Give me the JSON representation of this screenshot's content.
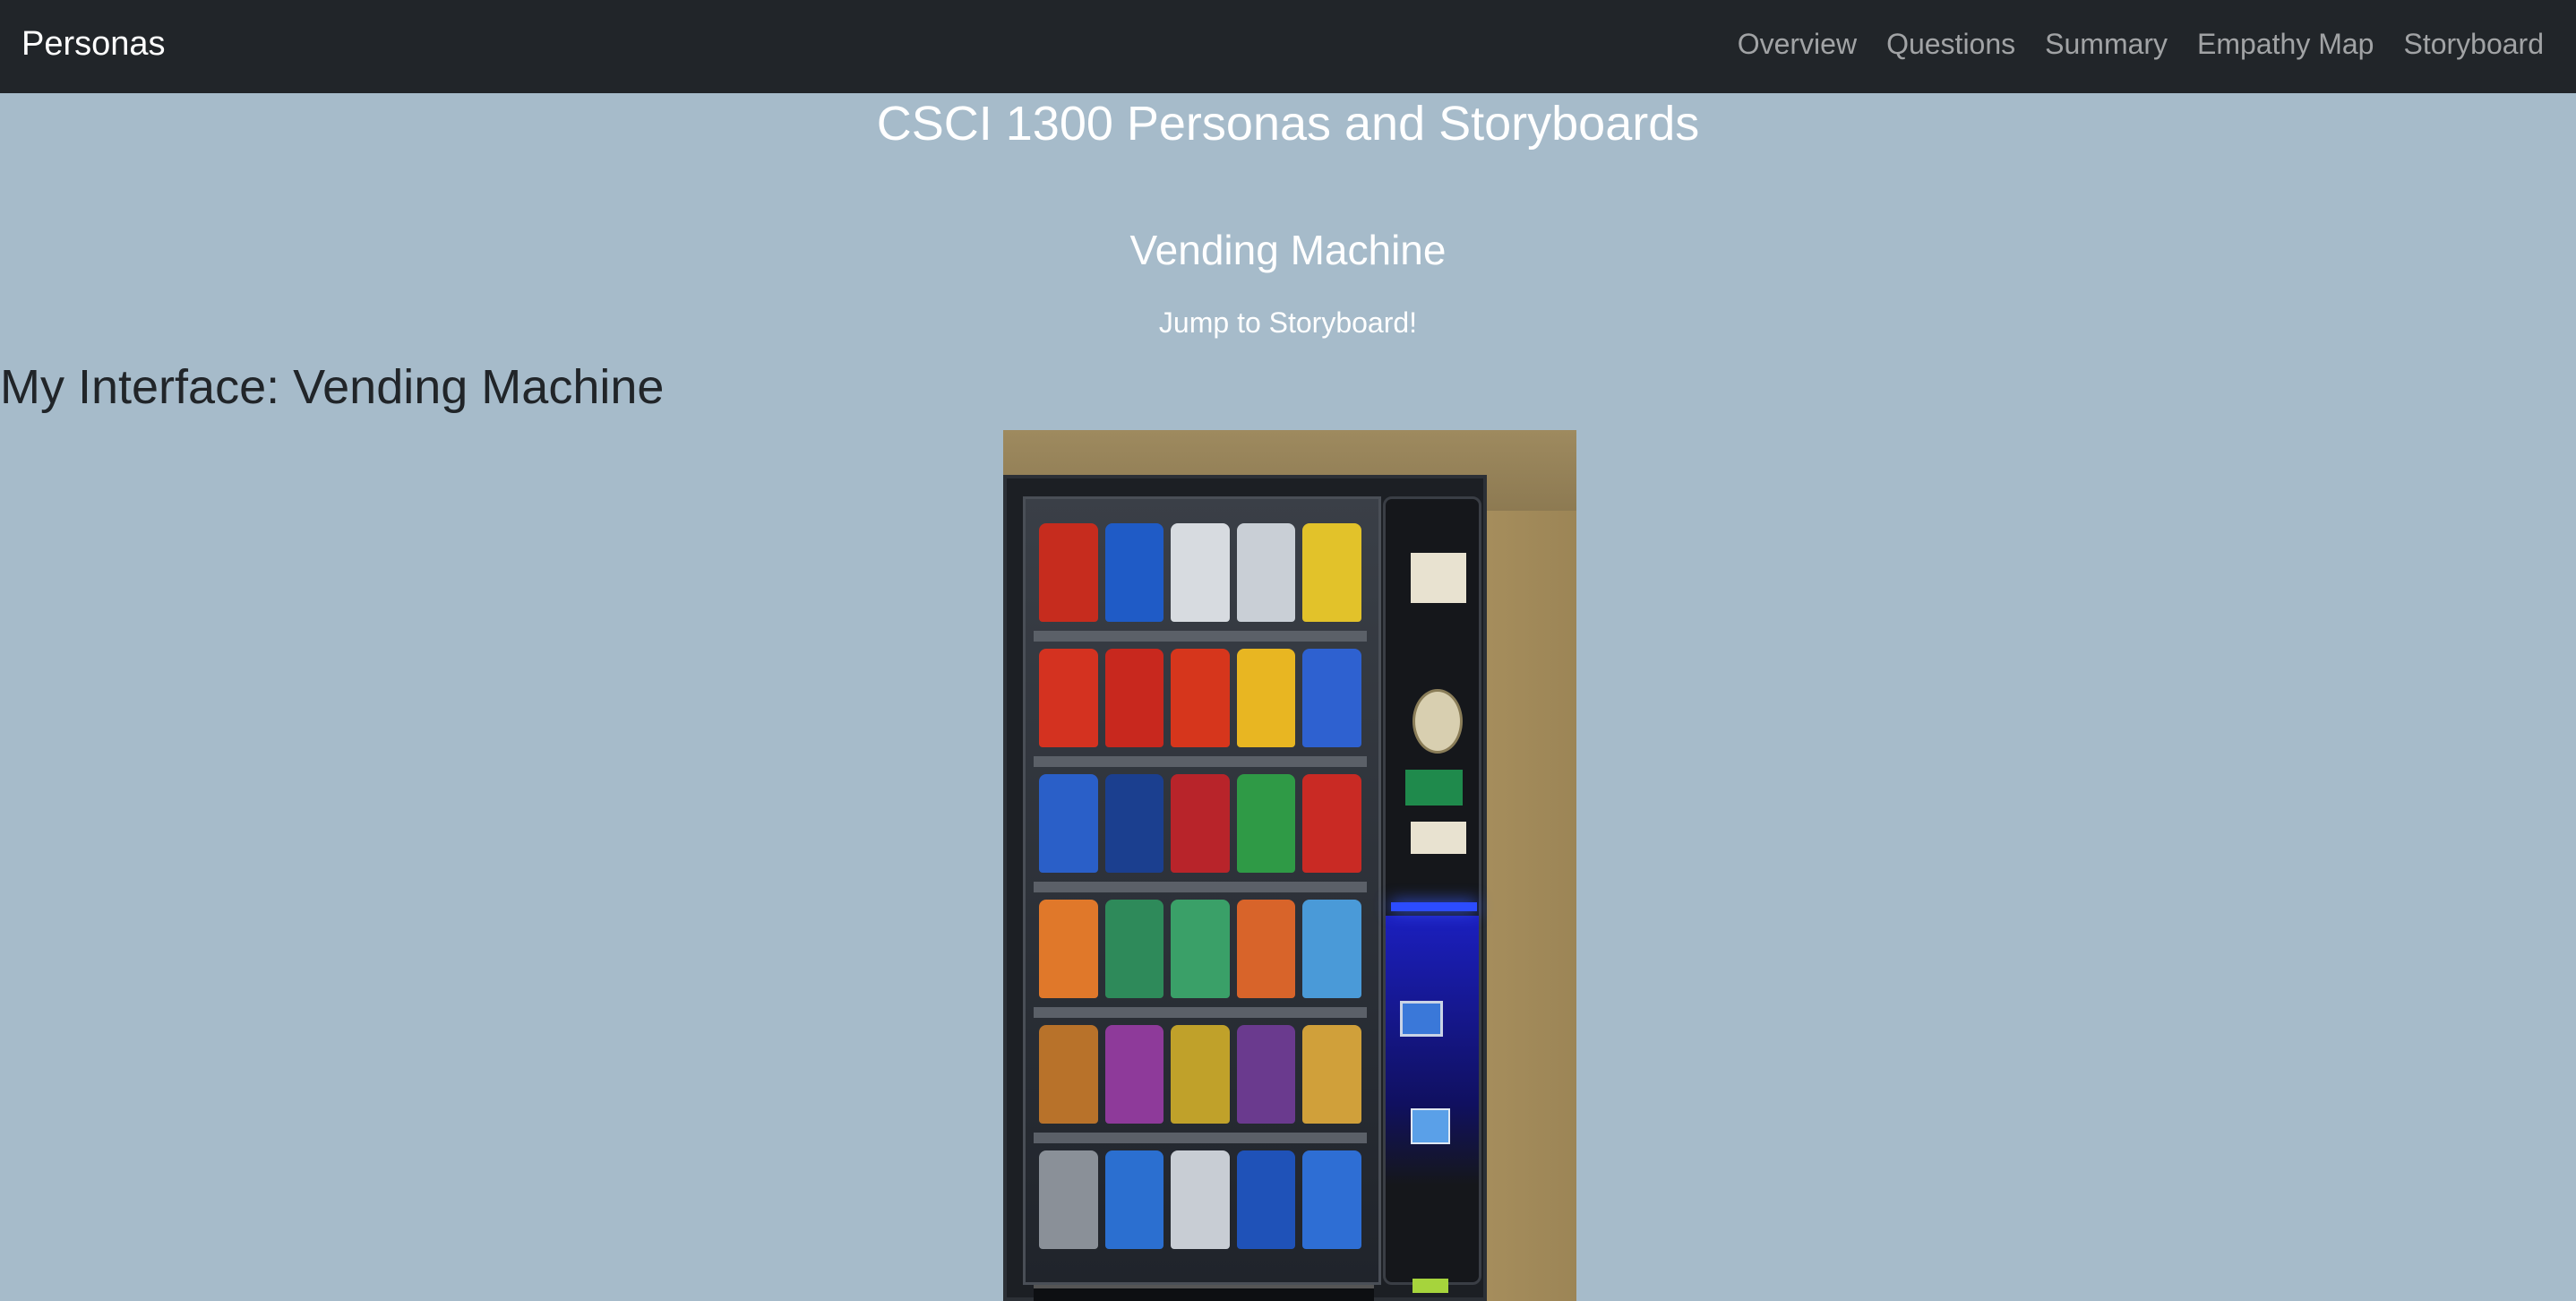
{
  "navbar": {
    "brand": "Personas",
    "links": [
      "Overview",
      "Questions",
      "Summary",
      "Empathy Map",
      "Storyboard"
    ]
  },
  "header": {
    "title": "CSCI 1300 Personas and Storyboards",
    "subtitle": "Vending Machine",
    "jump_link": "Jump to Storyboard!"
  },
  "section": {
    "heading": "My Interface: Vending Machine"
  },
  "colors": {
    "page_background": "#a6bbca",
    "navbar_background": "#212529",
    "heading_dark": "#212529"
  }
}
